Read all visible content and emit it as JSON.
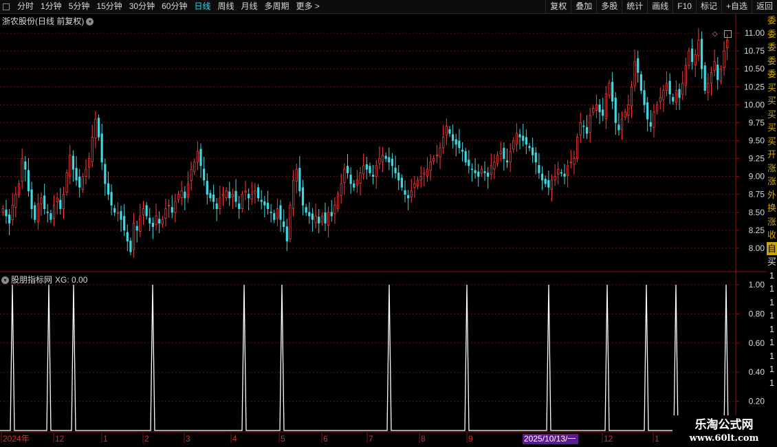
{
  "toolbar": {
    "periods": [
      "分时",
      "1分钟",
      "5分钟",
      "15分钟",
      "30分钟",
      "60分钟",
      "日线",
      "周线",
      "月线",
      "多周期",
      "更多 >"
    ],
    "active_period": "日线",
    "actions": [
      "复权",
      "叠加",
      "多股",
      "统计",
      "画线",
      "F10",
      "标记",
      "+自选",
      "返回"
    ]
  },
  "main_chart": {
    "title": "浙农股份(日线 前复权)",
    "y_ticks": [
      "11.00",
      "10.75",
      "10.50",
      "10.25",
      "10.00",
      "9.75",
      "9.50",
      "9.25",
      "9.00",
      "8.75",
      "8.50",
      "8.25",
      "8.00"
    ],
    "up_color": "#ff3c3c",
    "down_color": "#3fd8e0"
  },
  "indicator": {
    "name": "股朋指标网",
    "xg_text": "XG: 0.00",
    "y_ticks": [
      "1.00",
      "0.80",
      "0.60",
      "0.40",
      "0.20"
    ],
    "line_color": "#ffffff",
    "signal_bars": [
      18,
      71,
      107,
      222,
      355,
      410,
      566,
      679,
      798,
      883,
      940,
      983,
      1056
    ]
  },
  "x_axis": {
    "labels": [
      "2024年",
      "12",
      "1",
      "2",
      "3",
      "4",
      "5",
      "6",
      "7",
      "8",
      "9",
      "2025/10/13/一",
      "12",
      "1"
    ],
    "date_badge": "2025/10/13/一"
  },
  "right_panel": {
    "chars": [
      "委",
      "委",
      "委",
      "委",
      "委",
      "买",
      "买",
      "买",
      "买",
      "买",
      "开",
      "涨",
      "涨",
      "外",
      "换",
      "涨",
      "收"
    ],
    "highlight": "自",
    "lower_chars": [
      "买",
      "1",
      "1",
      "1",
      "1",
      "1",
      "1",
      "1",
      "1",
      "1"
    ]
  },
  "watermark": {
    "title": "乐淘公式网",
    "url": "www.60lt.com"
  },
  "chart_data": {
    "type": "candlestick",
    "title": "浙农股份(日线 前复权)",
    "ylim": [
      7.75,
      11.25
    ],
    "y_ticks": [
      8.0,
      8.25,
      8.5,
      8.75,
      9.0,
      9.25,
      9.5,
      9.75,
      10.0,
      10.25,
      10.5,
      10.75,
      11.0
    ],
    "close_series": [
      8.55,
      8.45,
      8.35,
      8.6,
      8.75,
      8.9,
      9.25,
      9.1,
      8.8,
      8.55,
      8.4,
      8.62,
      8.7,
      8.55,
      8.5,
      8.4,
      8.6,
      8.7,
      8.55,
      8.75,
      9.05,
      9.3,
      9.1,
      8.95,
      8.85,
      9.0,
      9.1,
      9.25,
      9.55,
      9.8,
      9.55,
      9.2,
      8.9,
      8.75,
      8.6,
      8.5,
      8.5,
      8.4,
      8.25,
      8.1,
      7.95,
      8.35,
      8.25,
      8.45,
      8.55,
      8.45,
      8.35,
      8.3,
      8.45,
      8.35,
      8.4,
      8.55,
      8.6,
      8.5,
      8.65,
      8.75,
      8.8,
      8.7,
      8.9,
      9.1,
      9.2,
      9.35,
      9.15,
      8.95,
      8.75,
      8.7,
      8.65,
      8.55,
      8.7,
      8.75,
      8.8,
      8.7,
      8.75,
      8.65,
      8.55,
      8.75,
      8.8,
      8.7,
      8.75,
      8.8,
      8.7,
      8.65,
      8.6,
      8.55,
      8.5,
      8.4,
      8.55,
      8.4,
      8.3,
      8.1,
      8.6,
      8.95,
      9.1,
      8.8,
      8.6,
      8.5,
      8.45,
      8.4,
      8.45,
      8.35,
      8.45,
      8.35,
      8.5,
      8.45,
      8.6,
      8.75,
      8.9,
      9.1,
      9.05,
      8.9,
      8.85,
      8.95,
      9.05,
      9.15,
      9.1,
      9.05,
      9.0,
      9.15,
      9.25,
      9.3,
      9.25,
      9.2,
      9.15,
      9.05,
      8.95,
      8.85,
      8.75,
      8.7,
      8.8,
      8.9,
      8.95,
      9.0,
      9.05,
      9.1,
      9.2,
      9.25,
      9.3,
      9.4,
      9.55,
      9.7,
      9.6,
      9.5,
      9.45,
      9.4,
      9.35,
      9.2,
      9.15,
      9.1,
      9.05,
      9.0,
      9.1,
      9.05,
      9.0,
      9.15,
      9.2,
      9.3,
      9.35,
      9.25,
      9.2,
      9.35,
      9.5,
      9.6,
      9.55,
      9.5,
      9.45,
      9.4,
      9.3,
      9.2,
      9.05,
      8.95,
      8.9,
      8.85,
      8.95,
      9.0,
      9.1,
      9.05,
      9.0,
      9.15,
      9.2,
      9.25,
      9.55,
      9.75,
      9.7,
      9.6,
      9.85,
      9.95,
      10.0,
      9.9,
      9.85,
      10.15,
      10.3,
      10.05,
      9.75,
      9.65,
      9.8,
      9.9,
      10.0,
      10.25,
      10.6,
      10.45,
      10.2,
      10.0,
      9.8,
      9.7,
      9.9,
      10.0,
      10.1,
      10.2,
      10.3,
      10.15,
      10.05,
      10.2,
      10.1,
      10.3,
      10.55,
      10.75,
      10.6,
      10.7,
      10.9,
      10.5,
      10.2,
      10.3,
      10.45,
      10.6,
      10.35,
      10.5,
      10.75,
      10.9
    ],
    "signal_series": {
      "name": "XG",
      "values": [
        1,
        1,
        1,
        1,
        1,
        1,
        1,
        1,
        1,
        1,
        1,
        1,
        1
      ]
    }
  }
}
